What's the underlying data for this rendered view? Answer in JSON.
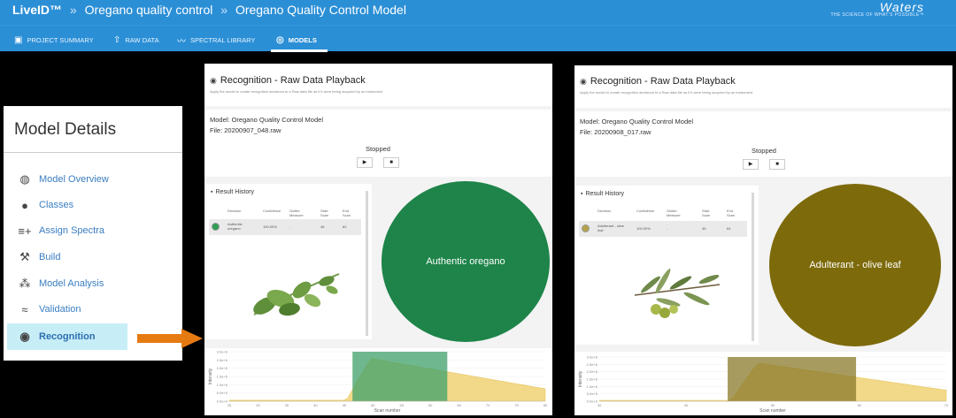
{
  "header": {
    "app_name": "LiveID™",
    "separator": "»",
    "crumb_1": "Oregano quality control",
    "crumb_2": "Oregano Quality Control Model",
    "brand_logo": "Waters",
    "brand_tagline": "THE SCIENCE OF WHAT'S POSSIBLE™",
    "color": "#2b8fd6"
  },
  "nav": {
    "items": [
      {
        "label": "PROJECT SUMMARY",
        "icon": "folder-icon"
      },
      {
        "label": "RAW DATA",
        "icon": "upload-icon"
      },
      {
        "label": "SPECTRAL LIBRARY",
        "icon": "spectrum-icon"
      },
      {
        "label": "MODELS",
        "icon": "models-icon",
        "active": true
      }
    ]
  },
  "model_details": {
    "title": "Model Details",
    "items": [
      {
        "label": "Model Overview",
        "icon": "globe-icon"
      },
      {
        "label": "Classes",
        "icon": "palette-icon"
      },
      {
        "label": "Assign Spectra",
        "icon": "list-add-icon"
      },
      {
        "label": "Build",
        "icon": "hammer-icon"
      },
      {
        "label": "Model Analysis",
        "icon": "analysis-icon"
      },
      {
        "label": "Validation",
        "icon": "wifi-check-icon"
      },
      {
        "label": "Recognition",
        "icon": "eye-icon",
        "active": true
      }
    ]
  },
  "playback_left": {
    "title": "Recognition - Raw Data Playback",
    "subtitle": "Apply the model to create recognition decisions to a Raw data file as if it were being acquired by an instrument",
    "model_label": "Model: Oregano Quality Control Model",
    "file_label": "File: 20200907_048.raw",
    "status": "Stopped",
    "play": "▶",
    "stop": "■",
    "history_title": "Result History",
    "columns": [
      "Decision",
      "Confidence",
      "Outlier Measure",
      "Start Scan",
      "End Scan"
    ],
    "row": [
      "Authentic oregano",
      "100.00%",
      "-",
      "46",
      "62"
    ],
    "result_label": "Authentic oregano",
    "result_color": "#1e8449",
    "chart": {
      "x_label": "Scan number",
      "y_label": "Intensity",
      "x_ticks": [
        "25",
        "30",
        "35",
        "40",
        "45",
        "50",
        "55",
        "60",
        "65",
        "70",
        "75",
        "80"
      ],
      "y_ticks": [
        "0.0e+0",
        "5.0e+5",
        "1.0e+6",
        "1.5e+6",
        "2.0e+6",
        "2.5e+6",
        "3.0e+6"
      ],
      "highlight_color": "#3fa06a"
    }
  },
  "playback_right": {
    "title": "Recognition - Raw Data Playback",
    "subtitle": "Apply the model to create recognition decisions to a Raw data file as if it were being acquired by an instrument",
    "model_label": "Model: Oregano Quality Control Model",
    "file_label": "File: 20200908_017.raw",
    "status": "Stopped",
    "play": "▶",
    "stop": "■",
    "history_title": "Result History",
    "columns": [
      "Decision",
      "Confidence",
      "Outlier Measure",
      "Start Scan",
      "End Scan"
    ],
    "row": [
      "Adulterant - olive leaf",
      "100.00%",
      "-",
      "45",
      "64"
    ],
    "result_label": "Adulterant - olive leaf",
    "result_color": "#7d6a0a",
    "chart": {
      "x_label": "Scan number",
      "y_label": "Intensity",
      "x_ticks": [
        "30",
        "40",
        "50",
        "60",
        "70"
      ],
      "y_ticks": [
        "0.0e+0",
        "5.0e+5",
        "1.0e+6",
        "1.5e+6",
        "2.0e+6",
        "2.5e+6",
        "3.0e+6"
      ],
      "highlight_color": "#8a7a2a"
    }
  }
}
